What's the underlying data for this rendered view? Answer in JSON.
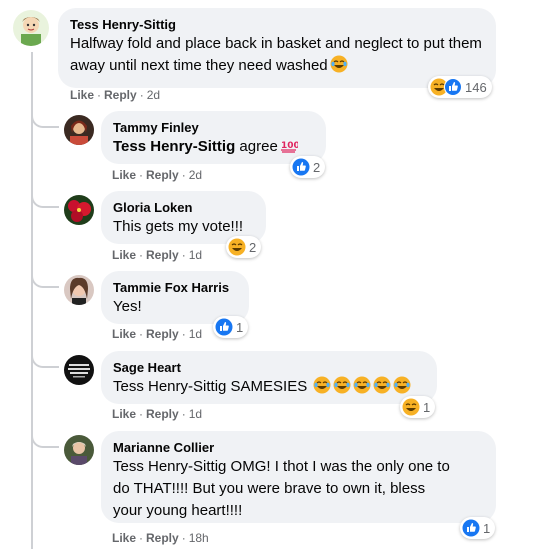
{
  "labels": {
    "like": "Like",
    "reply": "Reply",
    "separator": "·"
  },
  "colors": {
    "bubble": "#f0f2f5",
    "meta": "#65676b",
    "like_blue": "#1877f2",
    "haha_yellow": "#f7b125"
  },
  "comments": [
    {
      "author": "Tess Henry-Sittig",
      "text": "Halfway fold and place back in basket and neglect to put them away until next time they need washed",
      "inline_emoji": [
        "laughing-tears-icon"
      ],
      "time": "2d",
      "reactions": {
        "icons": [
          "haha-icon",
          "like-icon"
        ],
        "count": "146"
      }
    },
    {
      "author": "Tammy Finley",
      "mention": "Tess Henry-Sittig",
      "text": "agree",
      "inline_emoji": [
        "hundred-points-icon"
      ],
      "time": "2d",
      "reactions": {
        "icons": [
          "like-icon"
        ],
        "count": "2"
      }
    },
    {
      "author": "Gloria Loken",
      "text": "This gets my vote!!!",
      "time": "1d",
      "reactions": {
        "icons": [
          "haha-icon"
        ],
        "count": "2"
      }
    },
    {
      "author": "Tammie Fox Harris",
      "text": "Yes!",
      "time": "1d",
      "reactions": {
        "icons": [
          "like-icon"
        ],
        "count": "1"
      }
    },
    {
      "author": "Sage Heart",
      "text": "Tess Henry-Sittig SAMESIES",
      "inline_emoji": [
        "laughing-tears-icon",
        "laughing-tears-icon",
        "laughing-tears-icon",
        "laughing-tears-icon",
        "laughing-tears-icon"
      ],
      "time": "1d",
      "reactions": {
        "icons": [
          "haha-icon"
        ],
        "count": "1"
      }
    },
    {
      "author": "Marianne Collier",
      "text_lines": [
        "Tess Henry-Sittig OMG! I thot I was the only one to",
        "do THAT!!!! But you were brave to own it, bless",
        "your young heart!!!!"
      ],
      "time": "18h",
      "reactions": {
        "icons": [
          "like-icon"
        ],
        "count": "1"
      }
    }
  ]
}
